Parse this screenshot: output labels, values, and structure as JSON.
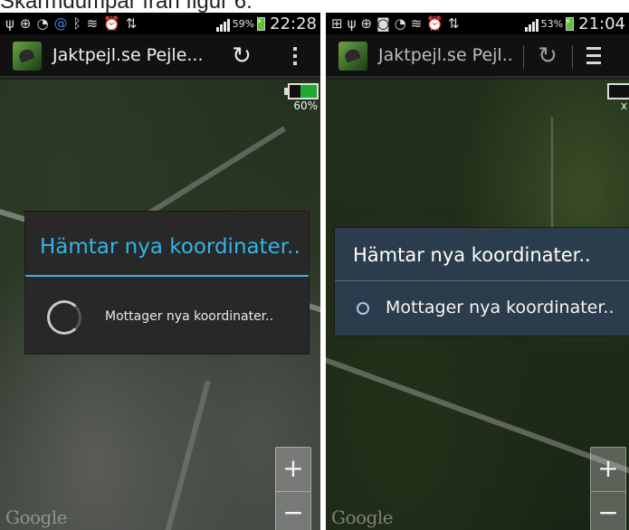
{
  "screens": [
    {
      "status_bar": {
        "icons": [
          "usb-icon",
          "gps-icon",
          "wifi-icon",
          "at-icon",
          "bluetooth-icon",
          "vibrate-icon",
          "alarm-icon",
          "data-transfer-icon"
        ],
        "battery_percent": "59%",
        "time": "22:28"
      },
      "action_bar": {
        "title": "Jaktpejl.se Pejle...",
        "refresh_icon": "refresh-icon",
        "overflow_icon": "overflow-menu-icon"
      },
      "map": {
        "battery_widget_percent": "60%",
        "battery_widget_level": 0.6,
        "google_watermark": "Google",
        "zoom_in": "+",
        "zoom_out": "−"
      },
      "dialog": {
        "title": "Hämtar nya koordinater..",
        "message": "Mottager nya koordinater..",
        "title_color": "#33b5e5"
      }
    },
    {
      "status_bar": {
        "icons": [
          "plus-icon",
          "usb-icon",
          "gps-icon",
          "camera-icon",
          "wifi-icon",
          "vibrate-icon",
          "alarm-icon",
          "data-transfer-icon"
        ],
        "battery_percent": "53%",
        "time": "21:04"
      },
      "action_bar": {
        "title": "Jaktpejl.se Pejl..",
        "refresh_icon": "refresh-icon",
        "menu_icon": "menu-icon"
      },
      "map": {
        "battery_widget_percent": "x",
        "google_watermark": "Google",
        "zoom_in": "+",
        "zoom_out": "−"
      },
      "dialog": {
        "title": "Hämtar nya koordinater..",
        "message": "Mottager nya koordinater.."
      }
    }
  ],
  "caption_fragment": "Skärmdumpar från figur 6."
}
